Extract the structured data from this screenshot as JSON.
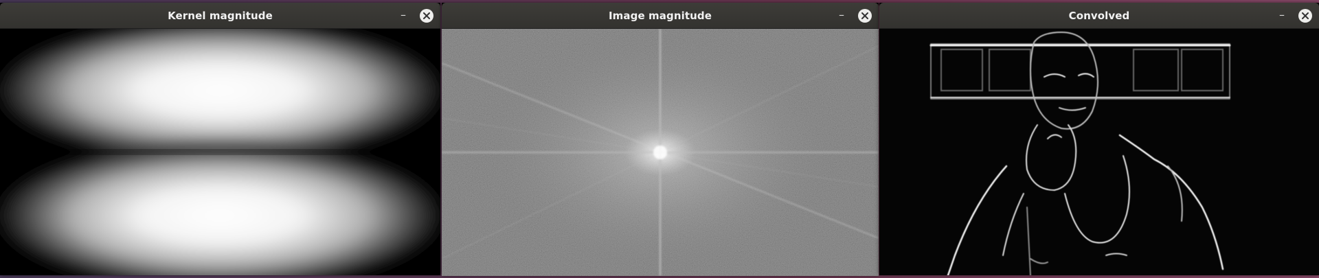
{
  "windows": [
    {
      "title": "Kernel magnitude",
      "content": "kernel-magnitude-image"
    },
    {
      "title": "Image magnitude",
      "content": "fft-magnitude-image"
    },
    {
      "title": "Convolved",
      "content": "convolved-edge-image"
    }
  ],
  "controls": {
    "minimize_glyph": "–",
    "close_glyph": "×"
  },
  "colors": {
    "titlebar": "#3a3935",
    "title_text": "#f2f2f2",
    "close_button_bg": "#eeeeec",
    "close_button_x": "#333333"
  },
  "icons": [
    "minimize-icon",
    "close-icon"
  ]
}
